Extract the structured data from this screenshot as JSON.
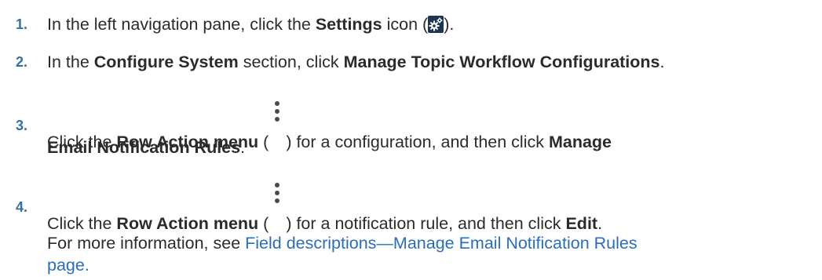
{
  "steps": [
    {
      "number": "1.",
      "pre": "In the left navigation pane, click the ",
      "bold1": "Settings",
      "mid": " icon (",
      "post": ")."
    },
    {
      "number": "2.",
      "pre": "In the ",
      "bold1": "Configure System",
      "mid": " section, click ",
      "bold2": "Manage Topic Workflow Configurations",
      "post": "."
    },
    {
      "number": "3.",
      "pre": "Click the ",
      "bold1": "Row Action menu",
      "mid": " (",
      "mid2": ") for a configuration, and then click ",
      "bold2": "Manage",
      "line2_bold": "Email Notification Rules",
      "post": "."
    },
    {
      "number": "4.",
      "pre": "Click the ",
      "bold1": "Row Action menu",
      "mid": " (",
      "mid2": ") for a notification rule, and then click ",
      "bold2": "Edit",
      "post": ".",
      "info_pre": "For more information, see ",
      "info_link_line1": "Field descriptions—Manage Email Notification Rules",
      "info_link_line2": "page."
    }
  ],
  "icons": {
    "settings": "settings-gear-icon",
    "row_action": "kebab-menu-icon",
    "settings_color": "#1c3550",
    "number_color": "#3a6fa6",
    "link_color": "#2a6ebb"
  }
}
